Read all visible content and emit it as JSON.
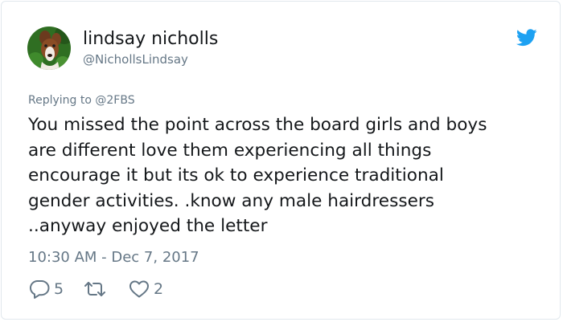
{
  "user": {
    "display_name": "lindsay nicholls",
    "handle": "@NichollsLindsay"
  },
  "reply_context": {
    "prefix": "Replying to",
    "mention": "@2FBS"
  },
  "tweet": {
    "text_lines": [
      "You missed the point across the board girls and boys",
      "are different love them experiencing all things",
      "encourage it but its ok to experience traditional",
      "gender activities. .know any male hairdressers",
      "..anyway enjoyed the letter"
    ],
    "timestamp": "10:30 AM - Dec 7, 2017"
  },
  "actions": {
    "reply": {
      "icon": "reply-bubble-icon",
      "count": "5"
    },
    "retweet": {
      "icon": "retweet-arrows-icon",
      "count": ""
    },
    "like": {
      "icon": "heart-icon",
      "count": "2"
    }
  },
  "colors": {
    "text_primary": "#14171a",
    "text_secondary": "#657786",
    "twitter_blue": "#1da1f2",
    "border": "#e1e8ed"
  }
}
